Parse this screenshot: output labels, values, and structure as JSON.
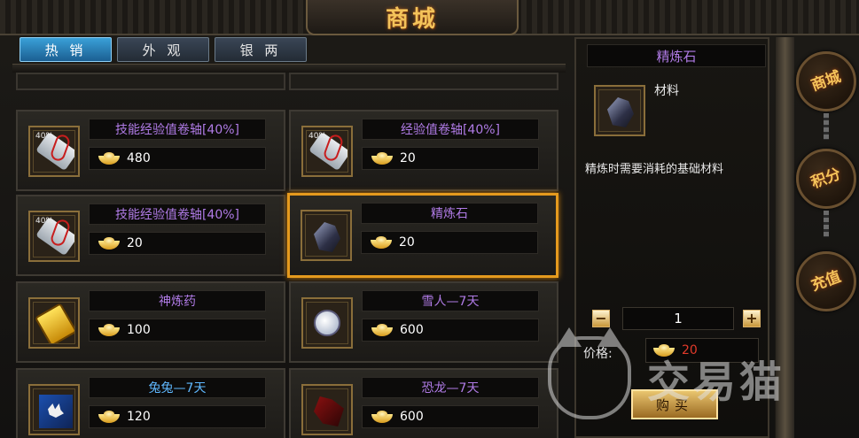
{
  "header": {
    "title": "商城"
  },
  "tabs": [
    {
      "label": "热 销",
      "active": true
    },
    {
      "label": "外 观",
      "active": false
    },
    {
      "label": "银 两",
      "active": false
    }
  ],
  "items": [
    {
      "name": "技能经验值卷轴[40%]",
      "price": "480",
      "badge": "40%",
      "icon": "scroll-icon",
      "name_color": "purple",
      "selected": false
    },
    {
      "name": "经验值卷轴[40%]",
      "price": "20",
      "badge": "40%",
      "icon": "scroll-icon",
      "name_color": "purple",
      "selected": false
    },
    {
      "name": "技能经验值卷轴[40%]",
      "price": "20",
      "badge": "40%",
      "icon": "scroll-icon",
      "name_color": "purple",
      "selected": false
    },
    {
      "name": "精炼石",
      "price": "20",
      "badge": "",
      "icon": "refining-stone-icon",
      "name_color": "purple",
      "selected": true
    },
    {
      "name": "神炼药",
      "price": "100",
      "badge": "",
      "icon": "potion-icon",
      "name_color": "purple",
      "selected": false
    },
    {
      "name": "雪人—7天",
      "price": "600",
      "badge": "",
      "icon": "snowman-icon",
      "name_color": "purple",
      "selected": false
    },
    {
      "name": "兔兔—7天",
      "price": "120",
      "badge": "",
      "icon": "rabbit-icon",
      "name_color": "blue",
      "selected": false
    },
    {
      "name": "恐龙—7天",
      "price": "600",
      "badge": "",
      "icon": "dinosaur-icon",
      "name_color": "purple",
      "selected": false
    }
  ],
  "detail": {
    "title": "精炼石",
    "category": "材料",
    "description": "精炼时需要消耗的基础材料",
    "minus": "−",
    "plus": "+",
    "quantity": "1",
    "price_label": "价格:",
    "price": "20",
    "buy_label": "购买"
  },
  "side_buttons": [
    {
      "label": "商城"
    },
    {
      "label": "积分"
    },
    {
      "label": "充值"
    }
  ],
  "watermark": {
    "text": "交易猫"
  },
  "colors": {
    "accent": "#e59a1e",
    "tab_active": "#2d8cc8",
    "item_name_purple": "#b07be6",
    "item_name_blue": "#5fb8ff",
    "price_red": "#e23a2a"
  }
}
